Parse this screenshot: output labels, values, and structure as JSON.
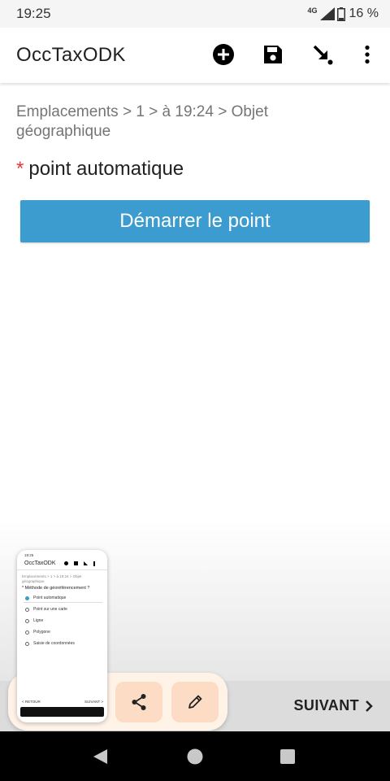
{
  "status_bar": {
    "time": "19:25",
    "network": "4G",
    "battery": "16 %"
  },
  "app_bar": {
    "title": "OccTaxODK",
    "icons": [
      "add-circle-icon",
      "save-icon",
      "jump-arrow-icon",
      "more-vert-icon"
    ]
  },
  "form": {
    "breadcrumb": "Emplacements > 1 > à 19:24 > Objet géographique",
    "required_mark": "*",
    "question": "point automatique",
    "start_button": "Démarrer le point"
  },
  "bottom_nav": {
    "next_label": "SUIVANT"
  },
  "screenshot_preview": {
    "title": "OccTaxODK",
    "time": "19:25",
    "breadcrumb": "Emplacements > 1 > à 19:24 > Objet géographique",
    "question": "* Méthode de géoréférencement ?",
    "options": [
      "Point automatique",
      "Point sur une carte",
      "Ligne",
      "Polygone",
      "Saisie de coordonnées"
    ],
    "footer_left": "< RETOUR",
    "footer_right": "SUIVANT >"
  },
  "colors": {
    "accent_button": "#3c9ccf",
    "required": "#e53935",
    "share_panel": "#fff3e8",
    "share_button": "#fddcc5"
  }
}
